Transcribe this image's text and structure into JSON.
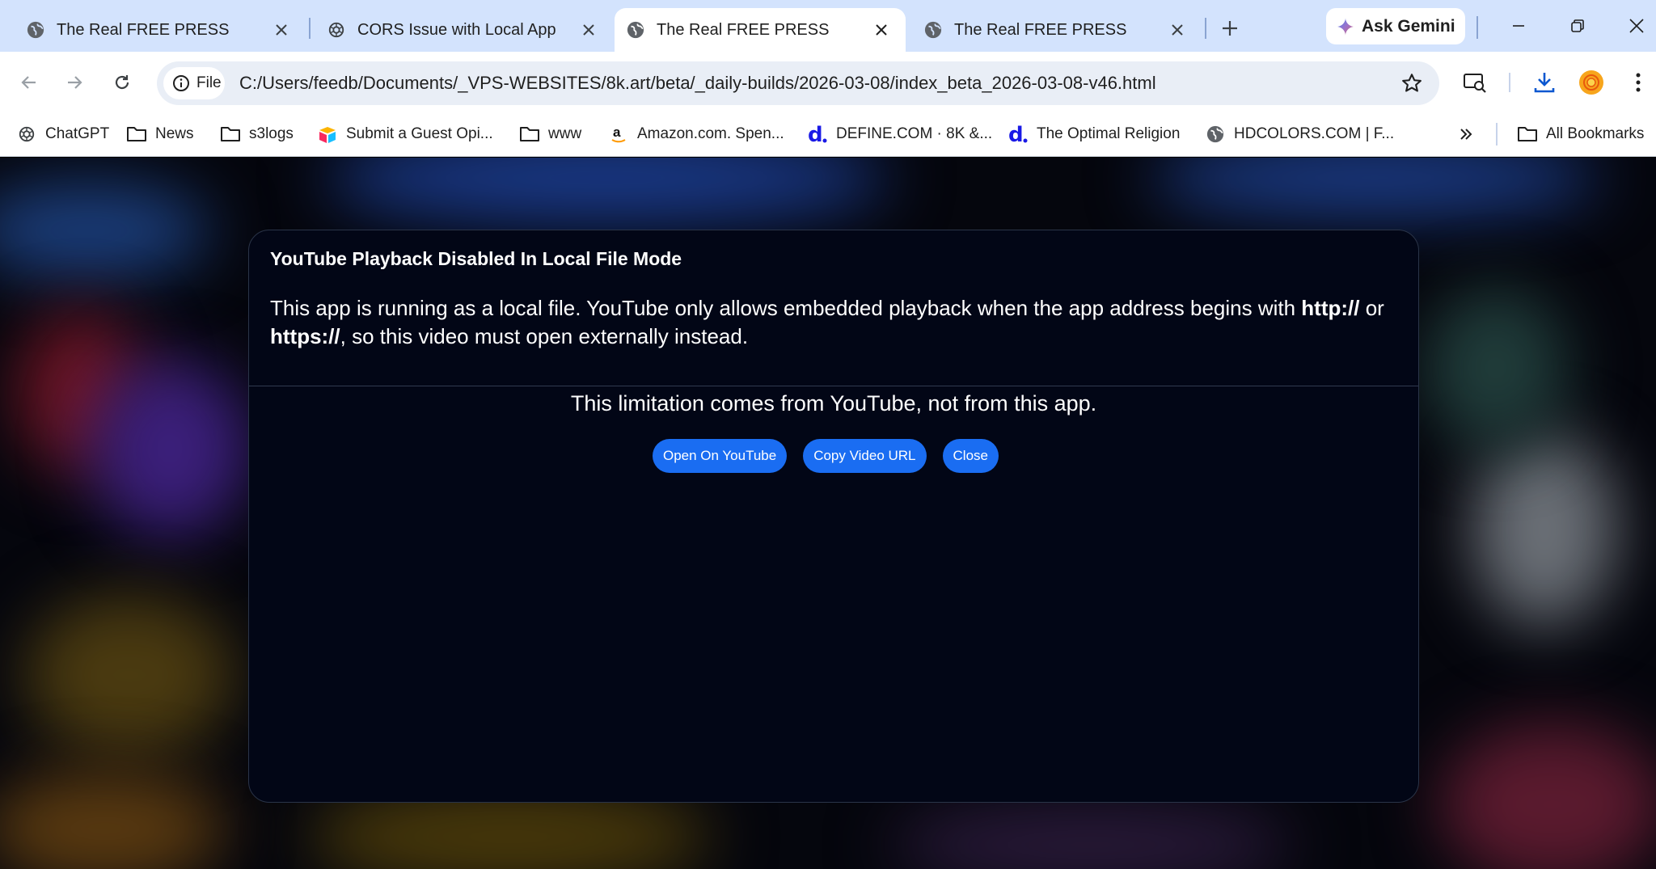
{
  "browser": {
    "tabs": [
      {
        "title": "The Real FREE PRESS",
        "icon": "globe-icon",
        "active": false
      },
      {
        "title": "CORS Issue with Local App",
        "icon": "chatgpt-icon",
        "active": false
      },
      {
        "title": "The Real FREE PRESS",
        "icon": "globe-icon",
        "active": true
      },
      {
        "title": "The Real FREE PRESS",
        "icon": "globe-icon",
        "active": false
      }
    ],
    "gemini_label": "Ask Gemini",
    "address": {
      "chip_label": "File",
      "url": "C:/Users/feedb/Documents/_VPS-WEBSITES/8k.art/beta/_daily-builds/2026-03-08/index_beta_2026-03-08-v46.html"
    },
    "bookmarks": [
      {
        "label": "ChatGPT",
        "icon": "chatgpt-icon"
      },
      {
        "label": "News",
        "icon": "folder-icon"
      },
      {
        "label": "s3logs",
        "icon": "folder-icon"
      },
      {
        "label": "Submit a Guest Opi...",
        "icon": "airtable-icon"
      },
      {
        "label": "www",
        "icon": "folder-icon"
      },
      {
        "label": "Amazon.com. Spen...",
        "icon": "amazon-icon"
      },
      {
        "label": "DEFINE.COM · 8K &...",
        "icon": "define-d-icon"
      },
      {
        "label": "The Optimal Religion",
        "icon": "define-d-icon"
      },
      {
        "label": "HDCOLORS.COM | F...",
        "icon": "globe-icon"
      }
    ],
    "all_bookmarks_label": "All Bookmarks"
  },
  "modal": {
    "title": "YouTube Playback Disabled In Local File Mode",
    "message_part1": "This app is running as a local file. YouTube only allows embedded playback when the app address begins with ",
    "message_http": "http://",
    "message_part2": " or ",
    "message_https": "https://",
    "message_part3": ", so this video must open externally instead.",
    "note": "This limitation comes from YouTube, not from this app.",
    "buttons": {
      "open": "Open On YouTube",
      "copy": "Copy Video URL",
      "close": "Close"
    }
  },
  "colors": {
    "tabstrip_bg": "#d3e3fd",
    "modal_bg": "#020616",
    "button_accent": "#1a6df2"
  }
}
